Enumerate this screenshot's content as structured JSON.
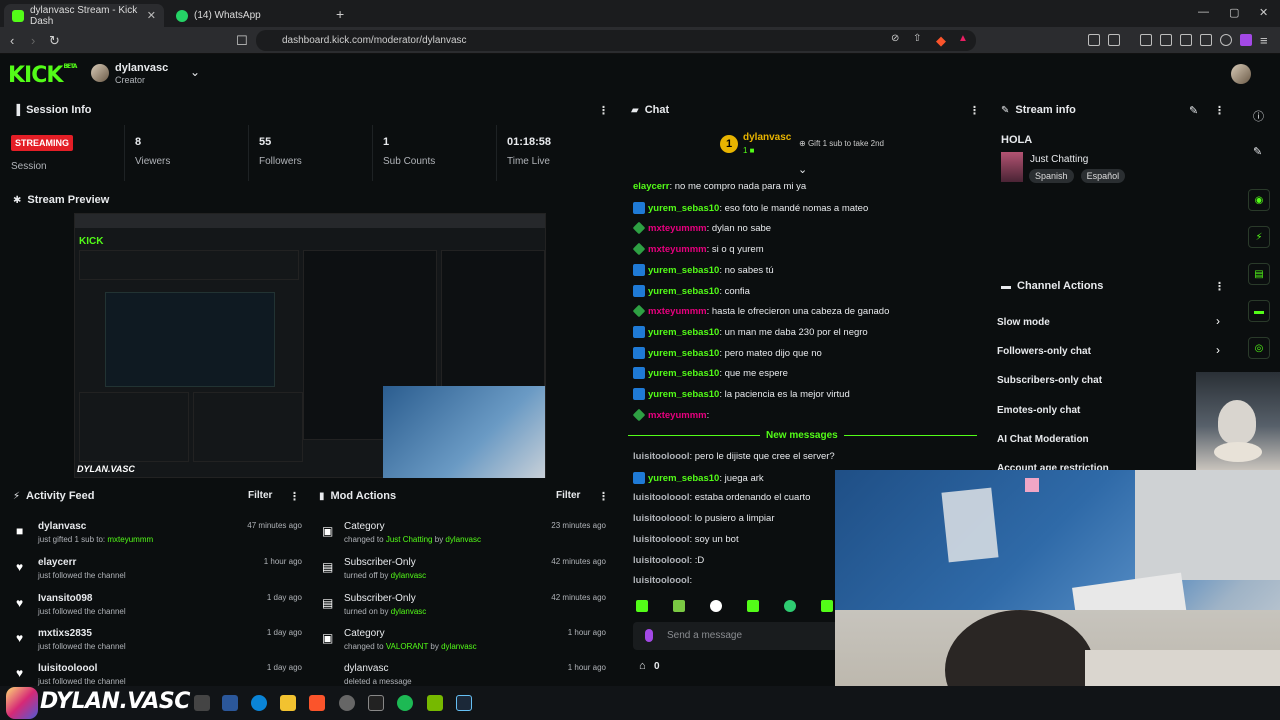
{
  "browser": {
    "tabs": [
      {
        "label": "dylanvasc Stream - Kick Dash"
      },
      {
        "label": "(14) WhatsApp"
      }
    ],
    "url": "dashboard.kick.com/moderator/dylanvasc"
  },
  "header": {
    "logo": "KICK",
    "logo_beta": "BETA",
    "username": "dylanvasc",
    "role": "Creator"
  },
  "session": {
    "title": "Session Info",
    "status": "STREAMING",
    "status_label": "Session",
    "stats": [
      {
        "value": "8",
        "label": "Viewers"
      },
      {
        "value": "55",
        "label": "Followers"
      },
      {
        "value": "1",
        "label": "Sub Counts"
      },
      {
        "value": "01:18:58",
        "label": "Time Live"
      }
    ]
  },
  "preview": {
    "title": "Stream Preview"
  },
  "activity": {
    "title": "Activity Feed",
    "filter": "Filter",
    "items": [
      {
        "user": "dylanvasc",
        "action": "just gifted 1 sub to: mxteyummm",
        "time": "47 minutes ago"
      },
      {
        "user": "elaycerr",
        "action": "just followed the channel",
        "time": "1 hour ago"
      },
      {
        "user": "Ivansito098",
        "action": "just followed the channel",
        "time": "1 day ago"
      },
      {
        "user": "mxtixs2835",
        "action": "just followed the channel",
        "time": "1 day ago"
      },
      {
        "user": "luisitooloool",
        "action": "just followed the channel",
        "time": "1 day ago"
      }
    ]
  },
  "mod": {
    "title": "Mod Actions",
    "filter": "Filter",
    "items": [
      {
        "title": "Category",
        "pre": "changed to ",
        "target": "Just Chatting",
        "mid": " by ",
        "by": "dylanvasc",
        "time": "23 minutes ago"
      },
      {
        "title": "Subscriber-Only",
        "pre": "turned off by ",
        "target": "",
        "mid": "",
        "by": "dylanvasc",
        "time": "42 minutes ago"
      },
      {
        "title": "Subscriber-Only",
        "pre": "turned on by ",
        "target": "",
        "mid": "",
        "by": "dylanvasc",
        "time": "42 minutes ago"
      },
      {
        "title": "Category",
        "pre": "changed to ",
        "target": "VALORANT",
        "mid": " by ",
        "by": "dylanvasc",
        "time": "1 hour ago"
      },
      {
        "title": "dylanvasc",
        "pre": "deleted a message",
        "target": "",
        "mid": "",
        "by": "",
        "time": "1 hour ago"
      }
    ]
  },
  "chat": {
    "title": "Chat",
    "pinned_user": "dylanvasc",
    "pinned_count": "1",
    "pinned_text": "Gift 1 sub to take 2nd",
    "messages": [
      {
        "user": "elaycerr",
        "text": ": no me compro nada para mi ya",
        "color": "#53fc18"
      },
      {
        "user": "yurem_sebas10",
        "text": ": eso foto le mandé nomas a mateo",
        "color": "#53fc18"
      },
      {
        "user": "mxteyummm",
        "text": ": dylan no sabe",
        "color": "#e6007e"
      },
      {
        "user": "mxteyummm",
        "text": ": si o q yurem",
        "color": "#e6007e"
      },
      {
        "user": "yurem_sebas10",
        "text": ": no sabes tú",
        "color": "#53fc18"
      },
      {
        "user": "yurem_sebas10",
        "text": ": confia",
        "color": "#53fc18"
      },
      {
        "user": "mxteyummm",
        "text": ": hasta le ofrecieron una cabeza de ganado",
        "color": "#e6007e"
      },
      {
        "user": "yurem_sebas10",
        "text": ": un man me daba 230 por el negro",
        "color": "#53fc18"
      },
      {
        "user": "yurem_sebas10",
        "text": ": pero mateo dijo que no",
        "color": "#53fc18"
      },
      {
        "user": "yurem_sebas10",
        "text": ": que me espere",
        "color": "#53fc18"
      },
      {
        "user": "yurem_sebas10",
        "text": ": la paciencia es la mejor virtud",
        "color": "#53fc18"
      },
      {
        "user": "mxteyummm",
        "text": ":",
        "color": "#e6007e"
      }
    ],
    "new_messages": "New messages",
    "messages2": [
      {
        "user": "luisitooloool",
        "text": ": pero le dijiste que cree el server?",
        "color": "#b0b3b8"
      },
      {
        "user": "yurem_sebas10",
        "text": ": juega ark",
        "color": "#53fc18"
      },
      {
        "user": "luisitooloool",
        "text": ": estaba ordenando el cuarto",
        "color": "#b0b3b8"
      },
      {
        "user": "luisitooloool",
        "text": ": lo pusiero a limpiar",
        "color": "#b0b3b8"
      },
      {
        "user": "luisitooloool",
        "text": ": soy un bot",
        "color": "#b0b3b8"
      },
      {
        "user": "luisitooloool",
        "text": ": :D",
        "color": "#b0b3b8"
      },
      {
        "user": "luisitooloool",
        "text": ":",
        "color": "#b0b3b8"
      }
    ],
    "input_placeholder": "Send a message",
    "points": "0"
  },
  "stream_info": {
    "title": "Stream info",
    "stream_title": "HOLA",
    "category": "Just Chatting",
    "tags": [
      "Spanish",
      "Español"
    ]
  },
  "channel_actions": {
    "title": "Channel Actions",
    "items": [
      "Slow mode",
      "Followers-only chat",
      "Subscribers-only chat",
      "Emotes-only chat",
      "AI Chat Moderation",
      "Account age restriction"
    ]
  },
  "overlay": {
    "watermark": "DYLAN.VASC"
  }
}
